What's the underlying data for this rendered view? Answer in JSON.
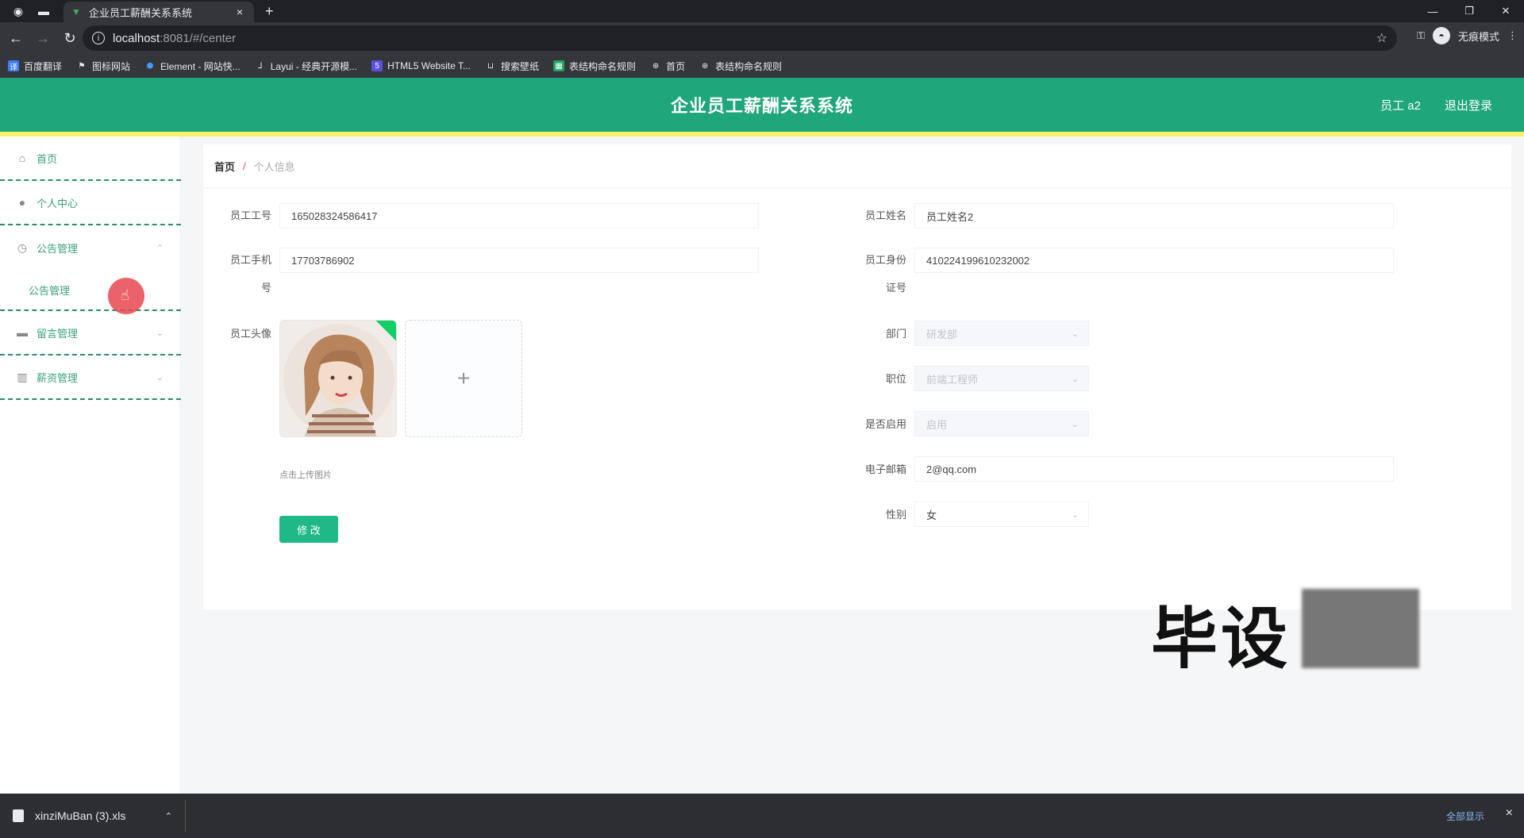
{
  "browser": {
    "tab_title": "企业员工薪酬关系系统",
    "tab_close": "×",
    "new_tab": "+",
    "url_host": "localhost",
    "url_path": ":8081/#/center",
    "incognito_label": "无痕模式",
    "bookmarks": [
      {
        "label": "百度翻译",
        "icon": "translate-icon",
        "color": "#3b7cf5"
      },
      {
        "label": "图标网站",
        "icon": "flag-icon",
        "color": "#e8eaed"
      },
      {
        "label": "Element - 网站快...",
        "icon": "element-icon",
        "color": "#409eff"
      },
      {
        "label": "Layui - 经典开源模...",
        "icon": "layui-icon",
        "color": "#e8eaed"
      },
      {
        "label": "HTML5 Website T...",
        "icon": "html5-icon",
        "color": "#5b4fe0"
      },
      {
        "label": "搜索壁纸",
        "icon": "wallpaper-icon",
        "color": "#e8eaed"
      },
      {
        "label": "表结构命名规则",
        "icon": "sheet-icon",
        "color": "#1fa463"
      },
      {
        "label": "首页",
        "icon": "globe-icon",
        "color": "#e8eaed"
      },
      {
        "label": "表结构命名规则",
        "icon": "globe-icon",
        "color": "#e8eaed"
      }
    ]
  },
  "header": {
    "title": "企业员工薪酬关系系统",
    "user": "员工 a2",
    "logout": "退出登录"
  },
  "sidebar": {
    "items": [
      {
        "label": "首页",
        "icon": "home-icon"
      },
      {
        "label": "个人中心",
        "icon": "user-icon"
      },
      {
        "label": "公告管理",
        "icon": "clock-icon"
      },
      {
        "label": "留言管理",
        "icon": "message-icon"
      },
      {
        "label": "薪资管理",
        "icon": "chart-icon"
      }
    ],
    "sub_item": "公告管理"
  },
  "breadcrumb": {
    "home": "首页",
    "sep": "/",
    "current": "个人信息"
  },
  "form": {
    "emp_no_label": "员工工号",
    "emp_no": "165028324586417",
    "emp_name_label": "员工姓名",
    "emp_name": "员工姓名2",
    "phone_label_1": "员工手机",
    "phone_label_2": "号",
    "phone": "17703786902",
    "id_label_1": "员工身份",
    "id_label_2": "证号",
    "id_no": "410224199610232002",
    "avatar_label": "员工头像",
    "upload_plus": "+",
    "upload_tip": "点击上传图片",
    "dept_label": "部门",
    "dept": "研发部",
    "position_label": "职位",
    "position": "前端工程师",
    "enabled_label": "是否启用",
    "enabled": "启用",
    "email_label": "电子邮箱",
    "email": "2@qq.com",
    "gender_label": "性别",
    "gender": "女",
    "edit_button": "修 改"
  },
  "watermark": "毕设",
  "downloads": {
    "file": "xinziMuBan (3).xls",
    "show_all": "全部显示",
    "close": "×"
  },
  "colors": {
    "header_green": "#1fa67a",
    "accent_yellow": "#f7f06a",
    "button_green": "#1fb886"
  }
}
